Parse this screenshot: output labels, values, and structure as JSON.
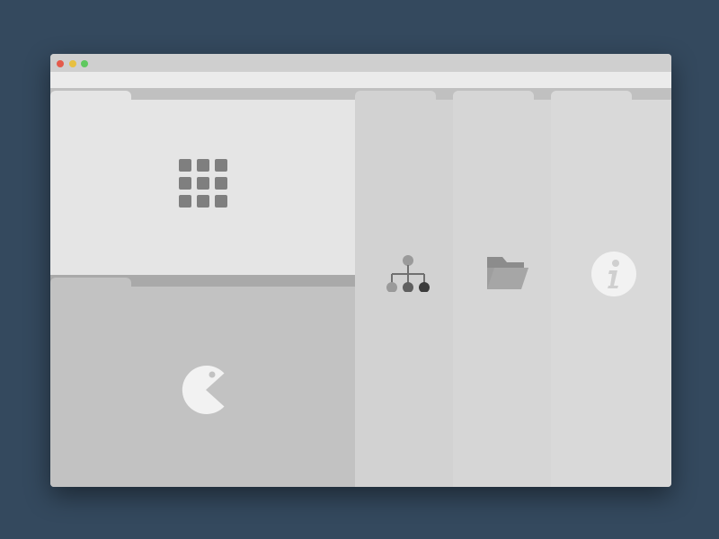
{
  "window": {
    "traffic_lights": {
      "close_color": "#e45a4b",
      "minimize_color": "#e8c040",
      "maximize_color": "#5fc85f"
    }
  },
  "panels": [
    {
      "id": "apps",
      "icon": "grid-icon"
    },
    {
      "id": "game",
      "icon": "pacman-icon"
    },
    {
      "id": "sitemap",
      "icon": "sitemap-icon"
    },
    {
      "id": "files",
      "icon": "folder-open-icon"
    },
    {
      "id": "info",
      "icon": "info-icon"
    }
  ],
  "colors": {
    "desktop_background": "#34495e",
    "icon_dark": "#7f7f7f",
    "icon_white": "#f2f2f2"
  }
}
